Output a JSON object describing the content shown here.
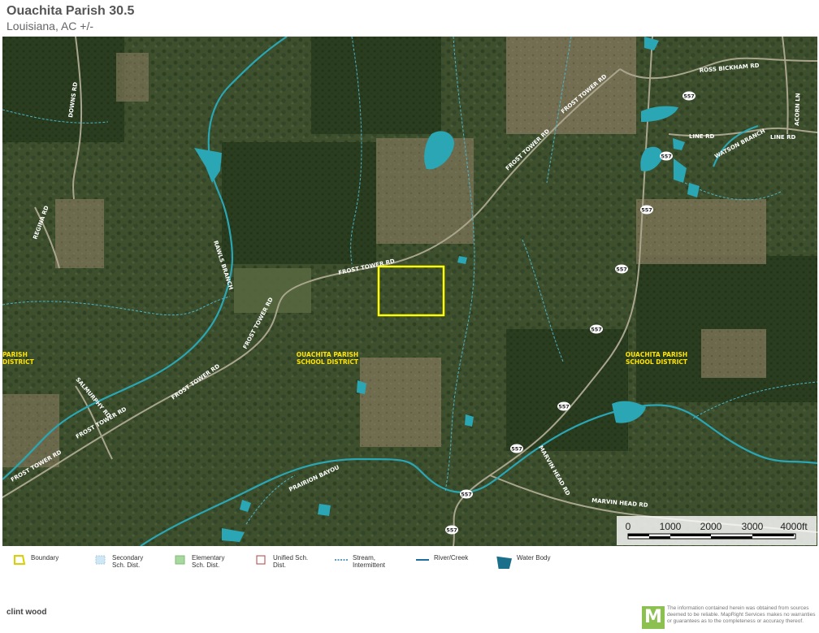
{
  "header": {
    "title": "Ouachita Parish 30.5",
    "subtitle": "Louisiana,  AC +/-"
  },
  "map": {
    "road_labels": {
      "downs_rd": "DOWNS RD",
      "regina_rd": "REGINA RD",
      "rawls_branch": "RAWLS BRANCH",
      "frost_tower_rd_1": "FROST TOWER RD",
      "frost_tower_rd_2": "FROST TOWER RD",
      "frost_tower_rd_3": "FROST TOWER RD",
      "frost_tower_rd_4": "FROST TOWER RD",
      "frost_tower_rd_5": "FROST TOWER RD",
      "frost_tower_rd_6": "FROST TOWER RD",
      "frost_tower_rd_7": "FROST TOWER RD",
      "salmurphy_rd": "SALMURPHY RD",
      "ross_bickham_rd": "ROSS BICKHAM RD",
      "line_rd_1": "LINE RD",
      "line_rd_2": "LINE RD",
      "watson_branch": "WATSON BRANCH",
      "acorn_ln": "ACORN LN",
      "prairion_bayou": "PRAIRION BAYOU",
      "marvin_head_rd_1": "MARVIN HEAD RD",
      "marvin_head_rd_2": "MARVIN HEAD RD"
    },
    "highway_shields": [
      "557",
      "557",
      "557",
      "557",
      "557",
      "557",
      "557",
      "557",
      "557"
    ],
    "school_districts": {
      "center_line1": "OUACHITA PARISH",
      "center_line2": "SCHOOL DISTRICT",
      "right_line1": "OUACHITA PARISH",
      "right_line2": "SCHOOL DISTRICT",
      "left_line1": "PARISH",
      "left_line2": "DISTRICT"
    },
    "scale": {
      "ticks": [
        "0",
        "1000",
        "2000",
        "3000",
        "4000ft"
      ]
    },
    "colors": {
      "boundary": "#ffff00",
      "water": "#2aa6b5",
      "district_label": "#ffe400"
    }
  },
  "legend": [
    {
      "icon": "boundary-icon",
      "label": "Boundary",
      "color": "#e8e000"
    },
    {
      "icon": "secondary-district-icon",
      "label": "Secondary Sch. Dist.",
      "color": "#cfe6f5"
    },
    {
      "icon": "elementary-district-icon",
      "label": "Elementary Sch. Dist.",
      "color": "#a8d8a0"
    },
    {
      "icon": "unified-district-icon",
      "label": "Unified Sch. Dist.",
      "color": "#b04040"
    },
    {
      "icon": "stream-icon",
      "label": "Stream, Intermittent",
      "color": "#2a7fb0"
    },
    {
      "icon": "river-icon",
      "label": "River/Creek",
      "color": "#1e6e9e"
    },
    {
      "icon": "water-body-icon",
      "label": "Water Body",
      "color": "#1a6f8a"
    }
  ],
  "footer": {
    "author": "clint wood",
    "logo_letter": "M",
    "disclaimer": "The information contained herein was obtained from sources deemed to be reliable. MapRight Services makes no warranties or guarantees as to the completeness or accuracy thereof."
  }
}
